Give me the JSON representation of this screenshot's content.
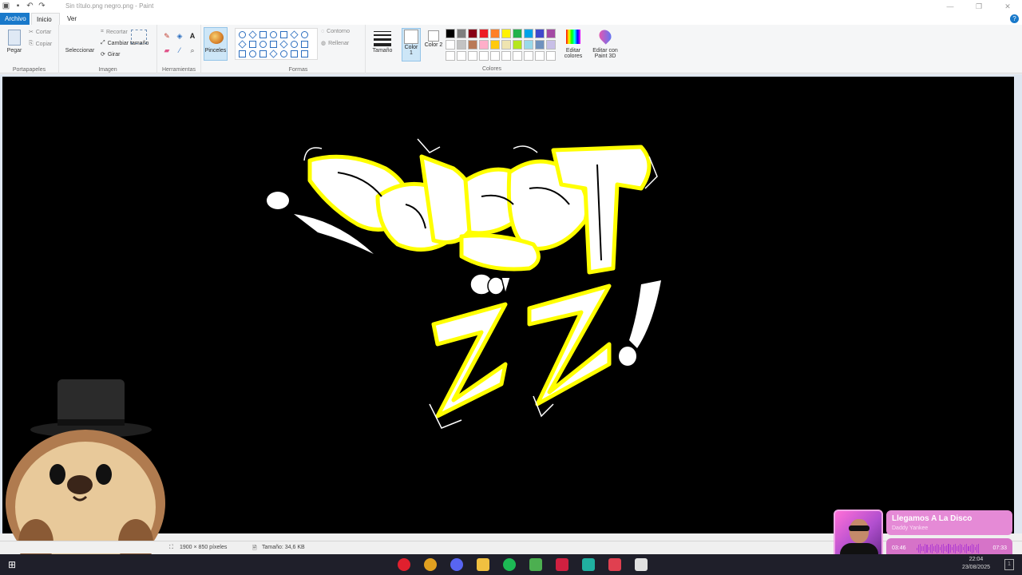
{
  "window": {
    "title": "Sin título.png negro.png - Paint",
    "controls": [
      "—",
      "❐",
      "✕"
    ]
  },
  "menu": {
    "file": "Archivo",
    "home": "Inicio",
    "view": "Ver"
  },
  "ribbon": {
    "clipboard": {
      "paste": "Pegar",
      "cut": "Cortar",
      "copy": "Copiar",
      "label": "Portapapeles"
    },
    "image": {
      "select": "Seleccionar",
      "crop": "Recortar",
      "resize": "Cambiar tamaño",
      "rotate": "Girar",
      "label": "Imagen"
    },
    "tools": {
      "label": "Herramientas",
      "text_tool": "A"
    },
    "brushes": {
      "label": "Pinceles"
    },
    "shapes": {
      "outline": "Contorno",
      "fill": "Rellenar",
      "label": "Formas"
    },
    "size": {
      "label": "Tamaño"
    },
    "colors": {
      "color1": "Color 1",
      "color2": "Color 2",
      "label": "Colores",
      "edit": "Editar colores",
      "paint3d": "Editar con Paint 3D",
      "palette": [
        "#000000",
        "#7f7f7f",
        "#880015",
        "#ed1c24",
        "#ff7f27",
        "#fff200",
        "#22b14c",
        "#00a2e8",
        "#3f48cc",
        "#a349a4",
        "#ffffff",
        "#c3c3c3",
        "#b97a57",
        "#ffaec9",
        "#ffc90e",
        "#efe4b0",
        "#b5e61d",
        "#99d9ea",
        "#7092be",
        "#c8bfe7",
        "#ffffff",
        "#ffffff",
        "#ffffff",
        "#ffffff",
        "#ffffff",
        "#ffffff",
        "#ffffff",
        "#ffffff",
        "#ffffff",
        "#ffffff"
      ]
    }
  },
  "status": {
    "dimensions": "1900 × 850 píxeles",
    "file_size": "Tamaño: 34,6 KB"
  },
  "canvas_art": {
    "word_top": "PODCAST",
    "word_mid": "con",
    "word_bottom": "ZZ!",
    "fill_color": "#ffffff",
    "outline_color": "#ffff00",
    "background": "#000000"
  },
  "music": {
    "title": "Llegamos A La Disco",
    "artist": "Daddy Yankee",
    "current": "03:46",
    "total": "07:33",
    "progress": 0.5
  },
  "taskbar": {
    "date": "23/08/2025",
    "time": "22:04",
    "apps": [
      "opera-icon",
      "chrome-icon",
      "discord-icon",
      "files-icon",
      "spotify-icon",
      "minecraft-icon",
      "app-x-icon",
      "terminal-icon",
      "valorant-icon",
      "paint-icon"
    ]
  }
}
